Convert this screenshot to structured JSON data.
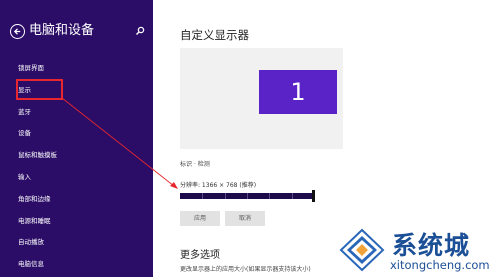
{
  "sidebar": {
    "title": "电脑和设备",
    "items": [
      {
        "label": "锁屏界面"
      },
      {
        "label": "显示"
      },
      {
        "label": "蓝牙"
      },
      {
        "label": "设备"
      },
      {
        "label": "鼠标和触摸板"
      },
      {
        "label": "输入"
      },
      {
        "label": "角部和边缘"
      },
      {
        "label": "电源和睡眠"
      },
      {
        "label": "自动播放"
      },
      {
        "label": "电脑信息"
      }
    ],
    "selected_index": 1
  },
  "main": {
    "title": "自定义显示器",
    "monitor_number": "1",
    "link_identify": "标识",
    "link_separator": "·",
    "link_detect": "检测",
    "resolution_label": "分辨率: 1366 × 768 (推荐)",
    "apply_label": "应用",
    "cancel_label": "取消",
    "more_title": "更多选项",
    "more_desc": "更改显示器上的应用大小(如果显示器支持该大小)"
  },
  "watermark": {
    "text": "系统城",
    "url": "xitongcheng.com"
  },
  "colors": {
    "sidebar_bg": "#2b0d67",
    "monitor_bg": "#5a23c8",
    "highlight": "#e8262e",
    "watermark": "#1b4f96"
  },
  "icons": {
    "back": "back-arrow-icon",
    "search": "search-icon"
  }
}
